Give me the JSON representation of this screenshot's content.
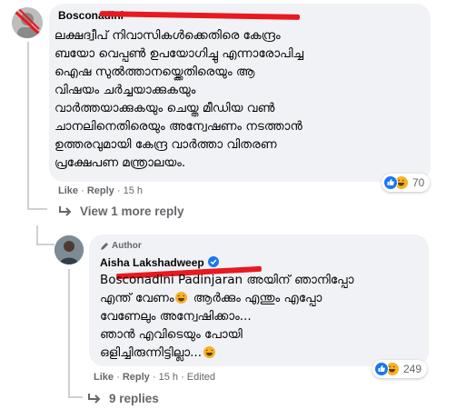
{
  "comment": {
    "author": "Bosconadini",
    "text_lines": [
      "ലക്ഷദ്വീപ് നിവാസികൾക്കെതിരെ കേന്ദ്രം",
      "ബയോ വെപ്പൺ ഉപയോഗിച്ചു എന്നാരോപിച്ച",
      "ഐഷ സുൽത്താനയ്ക്കെതിരെയും ആ",
      "വിഷയം ചർച്ചയാക്കുകയും",
      "വാർത്തയാക്കുകയും ചെയ്ത മീഡിയ വൺ",
      "ചാനലിനെതിരെയും അന്വേഷണം നടത്താൻ",
      "ഉത്തരവുമായി കേന്ദ്ര വാർത്താ വിതരണ",
      "പ്രക്ഷേപണ മന്ത്രാലയം."
    ],
    "like_label": "Like",
    "reply_label": "Reply",
    "separator": "·",
    "time": "15 h",
    "reaction_count": "70",
    "reactions": [
      "like-icon",
      "haha-icon"
    ]
  },
  "view_more": {
    "label": "View 1 more reply"
  },
  "reply": {
    "badge": "Author",
    "author": "Aisha Lakshadweep",
    "text_lines": [
      "Bosconadini Padinjaran അയിന് ഞാനിപ്പോ",
      "എന്ത് വേണം",
      " ആർക്കും എന്തും എപ്പോ",
      "വേണേലും അന്വേഷിക്കാം...",
      "ഞാൻ എവിടെയും പോയി",
      "ഒളിച്ചിരുന്നിട്ടില്ലാ..."
    ],
    "like_label": "Like",
    "reply_label": "Reply",
    "separator": "·",
    "time": "15 h",
    "edited": "Edited",
    "reaction_count": "249",
    "reactions": [
      "like-icon",
      "haha-icon"
    ]
  },
  "replies_link": {
    "label": "9 replies"
  },
  "colors": {
    "bubble": "#f0f2f5",
    "accent": "#1877f2",
    "muted": "#65676b",
    "redaction": "#e8191f"
  }
}
